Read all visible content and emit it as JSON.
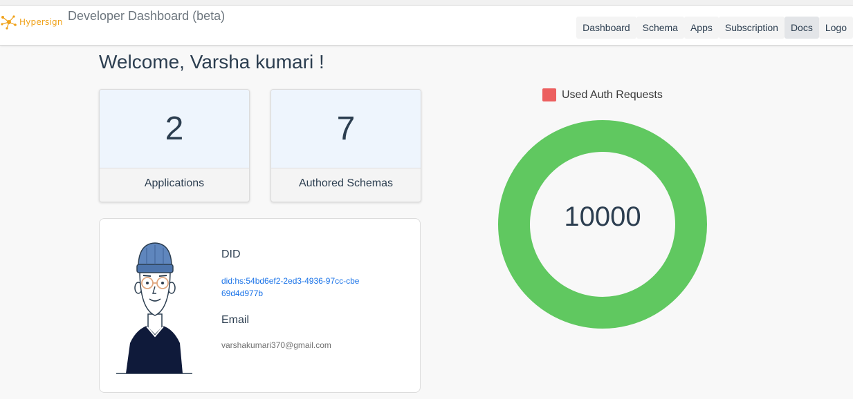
{
  "brand": {
    "name": "Hypersign",
    "accent_color": "#f0a21a"
  },
  "header": {
    "title": "Developer Dashboard (beta)"
  },
  "nav": [
    {
      "label": "Dashboard",
      "active": false
    },
    {
      "label": "Schema",
      "active": false
    },
    {
      "label": "Apps",
      "active": false
    },
    {
      "label": "Subscription",
      "active": false
    },
    {
      "label": "Docs",
      "active": true
    },
    {
      "label": "Logo",
      "active": false
    }
  ],
  "welcome": {
    "text": "Welcome, Varsha kumari !"
  },
  "stats": [
    {
      "value": "2",
      "label": "Applications"
    },
    {
      "value": "7",
      "label": "Authored Schemas"
    }
  ],
  "profile": {
    "did_label": "DID",
    "did_value": "did:hs:54bd6ef2-2ed3-4936-97cc-cbe69d4d977b",
    "email_label": "Email",
    "email_value": "varshakumari370@gmail.com",
    "avatar_icon": "user-avatar-illustration"
  },
  "chart_data": {
    "type": "pie",
    "legend": [
      "Used Auth Requests"
    ],
    "legend_color": "#ec5f5f",
    "ring_color": "#60c860",
    "series": [
      {
        "name": "Used Auth Requests",
        "value": 0
      },
      {
        "name": "",
        "value": 10000
      }
    ],
    "center_label": "10000"
  }
}
